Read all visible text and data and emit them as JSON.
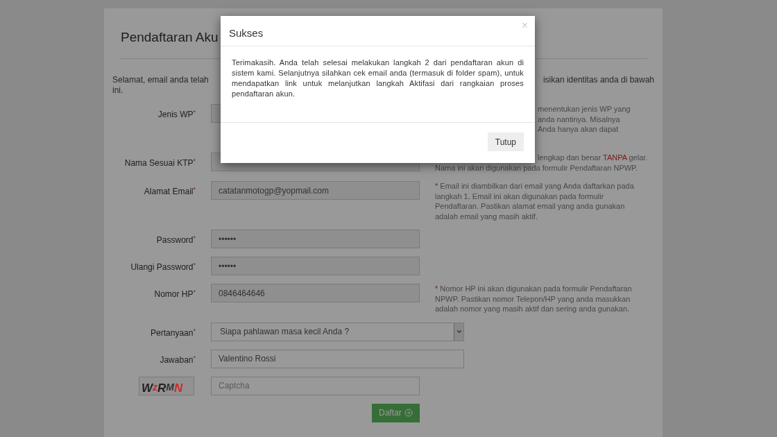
{
  "page": {
    "heading": "Pendaftaran Aku",
    "intro_left": "Selamat, email anda telah",
    "intro_right": "isikan identitas anda di bawah",
    "intro_line2": "ini."
  },
  "form": {
    "fields": [
      {
        "kind": "input",
        "label": "Jenis WP",
        "required": true,
        "hint": [
          [
            {
              "text": "menentukan jenis WP yang",
              "red": false
            }
          ],
          [
            {
              "text": "anda nantinya. Misalnya",
              "red": false
            }
          ],
          [
            {
              "text": "Anda hanya akan dapat",
              "red": false
            }
          ]
        ]
      },
      {
        "kind": "input",
        "label": "Nama Sesuai KTP",
        "required": true,
        "hint": [
          [
            {
              "text": "lengkap dan benar ",
              "red": false
            },
            {
              "text": "TANPA",
              "red": true
            },
            {
              "text": " gelar.",
              "red": false
            }
          ],
          [
            {
              "text": "Nama ini akan digunakan pada formulir Pendaftaran NPWP.",
              "red": false
            }
          ]
        ]
      },
      {
        "kind": "input",
        "label": "Alamat Email",
        "required": true,
        "value": "catatanmotogp@yopmail.com",
        "hint": [
          [
            {
              "text": "* ",
              "red": true
            },
            {
              "text": "Email ini diambilkan dari email yang Anda daftarkan pada",
              "red": false
            }
          ],
          [
            {
              "text": "langkah 1. Email ini akan digunakan pada formulir",
              "red": false
            }
          ],
          [
            {
              "text": "Pendaftaran. Pastikan alamat email yang anda gunakan",
              "red": false
            }
          ],
          [
            {
              "text": "adalah email yang masih aktif.",
              "red": false
            }
          ]
        ]
      },
      {
        "kind": "input",
        "label": "Password",
        "required": true,
        "value": "••••••"
      },
      {
        "kind": "input",
        "label": "Ulangi Password",
        "required": true,
        "value": "••••••"
      },
      {
        "kind": "input",
        "label": "Nomor HP",
        "required": true,
        "value": "0846464646",
        "hint": [
          [
            {
              "text": "* ",
              "red": true
            },
            {
              "text": "Nomor HP ini akan digunakan pada formulir Pendaftaran",
              "red": false
            }
          ],
          [
            {
              "text": "NPWP. Pastikan nomor Telepon/HP yang anda masukkan",
              "red": false
            }
          ],
          [
            {
              "text": "adalah nomor yang masih aktif dan sering anda gunakan.",
              "red": false
            }
          ]
        ]
      },
      {
        "kind": "select",
        "label": "Pertanyaan",
        "required": true,
        "value": "Siapa pahlawan masa kecil Anda ?"
      },
      {
        "kind": "wide",
        "label": "Jawaban",
        "required": true,
        "value": "Valentino Rossi"
      },
      {
        "kind": "captcha",
        "letters": [
          {
            "char": "W",
            "color": "#222222"
          },
          {
            "char": "z",
            "color": "#d12a2a"
          },
          {
            "char": "R",
            "color": "#222222"
          },
          {
            "char": "M",
            "color": "#333333"
          },
          {
            "char": "N",
            "color": "#d12a2a"
          }
        ],
        "placeholder": "Captcha"
      }
    ],
    "submit": "Daftar"
  },
  "modal": {
    "title": "Sukses",
    "close": "×",
    "body": "Terimakasih. Anda telah selesai melakukan langkah 2 dari pendaftaran akun di sistem kami. Selanjutnya silahkan cek email anda (termasuk di folder spam), untuk mendapatkan link untuk melanjutkan langkah Aktifasi dari rangkaian proses pendaftaran akun.",
    "button": "Tutup"
  }
}
